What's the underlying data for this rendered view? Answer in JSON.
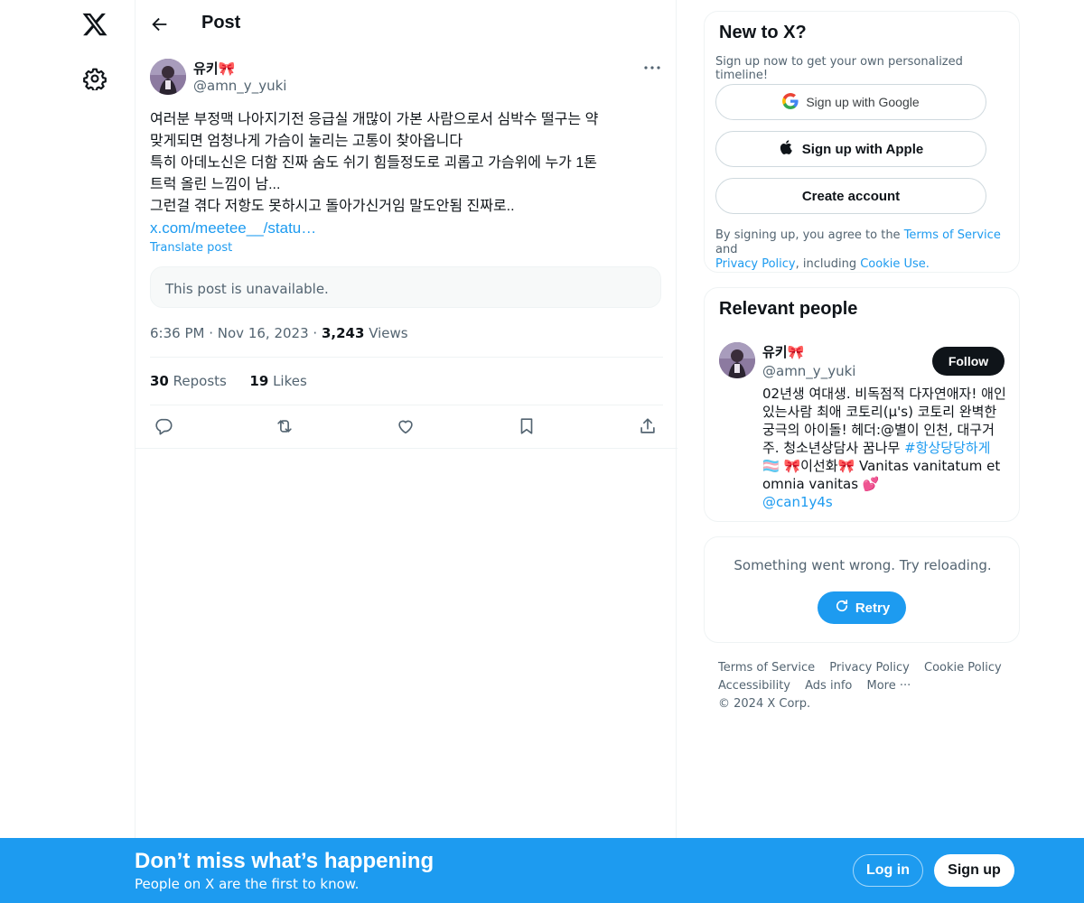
{
  "header": {
    "title": "Post"
  },
  "post": {
    "author_name": "유키🎀",
    "author_handle": "@amn_y_yuki",
    "lines": [
      "여러분 부정맥 나아지기전 응급실 개많이 가본 사람으로서 심박수 떨구는 약",
      "맞게되면 엄청나게 가슴이 눌리는 고통이 찾아옵니다",
      "특히 아데노신은 더함 진짜 숨도 쉬기 힘들정도로 괴롭고 가슴위에 누가 1톤",
      "트럭 올린 느낌이 남...",
      "그런걸 겪다 저항도 못하시고 돌아가신거임 말도안됨 진짜로.."
    ],
    "link": "x.com/meetee__/statu…",
    "translate": "Translate post",
    "quoted_unavailable": "This post is unavailable.",
    "time": "6:36 PM",
    "date": "Nov 16, 2023",
    "views_count": "3,243",
    "views_label": "Views",
    "reposts_count": "30",
    "reposts_label": "Reposts",
    "likes_count": "19",
    "likes_label": "Likes"
  },
  "signup_card": {
    "title": "New to X?",
    "subtitle": "Sign up now to get your own personalized timeline!",
    "google": "Sign up with Google",
    "apple": "Sign up with Apple",
    "create": "Create account",
    "legal_prefix": "By signing up, you agree to the ",
    "terms": "Terms of Service",
    "and": " and",
    "privacy": "Privacy Policy",
    "including": ", including ",
    "cookie": "Cookie Use."
  },
  "relevant": {
    "title": "Relevant people",
    "name": "유키🎀",
    "handle": "@amn_y_yuki",
    "follow": "Follow",
    "bio_1": "02년생 여대생. 비독점적 다자연애자! 애인있는사람 최애 코토리(μ's) 코토리 완벽한 궁극의 아이돌! 헤더:@별이 인천, 대구거주. 청소년상담사 꿈나무 ",
    "bio_tag": "#항상당당하게",
    "bio_2": " 🏳️‍⚧️ 🎀이선화🎀 Vanitas vanitatum et omnia vanitas 💕",
    "bio_mention": "@can1y4s"
  },
  "error_card": {
    "message": "Something went wrong. Try reloading.",
    "retry": "Retry"
  },
  "footer": {
    "terms": "Terms of Service",
    "privacy": "Privacy Policy",
    "cookie": "Cookie Policy",
    "accessibility": "Accessibility",
    "ads": "Ads info",
    "more": "More ···",
    "copyright": "© 2024 X Corp."
  },
  "banner": {
    "title": "Don’t miss what’s happening",
    "subtitle": "People on X are the first to know.",
    "login": "Log in",
    "signup": "Sign up"
  },
  "colors": {
    "accent": "#1d9bf0",
    "text": "#0f1419",
    "muted": "#536471"
  }
}
